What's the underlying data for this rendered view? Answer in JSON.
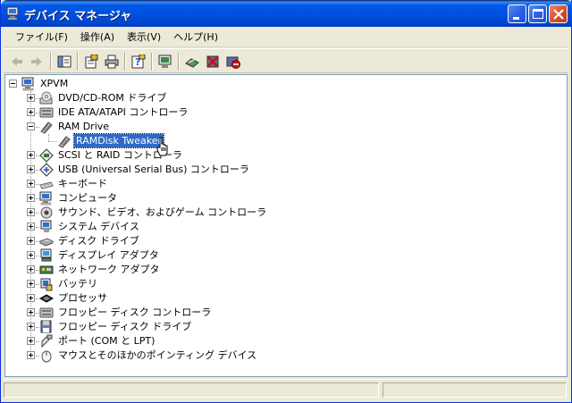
{
  "window": {
    "title": "デバイス マネージャ",
    "icon": "device-manager-icon",
    "controls": [
      "minimize-icon",
      "maximize-icon",
      "close-icon"
    ]
  },
  "menu": [
    {
      "label": "ファイル(F)"
    },
    {
      "label": "操作(A)"
    },
    {
      "label": "表示(V)"
    },
    {
      "label": "ヘルプ(H)"
    }
  ],
  "toolbar": {
    "icons": [
      "back-arrow-icon",
      "forward-arrow-icon",
      "show-hide-tree-icon",
      "properties-icon",
      "print-icon",
      "help-icon",
      "scan-hardware-icon",
      "update-driver-icon",
      "uninstall-icon",
      "disable-icon"
    ]
  },
  "tree": {
    "root": {
      "label": "XPVM",
      "icon": "computer-icon"
    },
    "categories": [
      {
        "label": "DVD/CD-ROM ドライブ",
        "icon": "cdrom-icon",
        "expanded": false
      },
      {
        "label": "IDE ATA/ATAPI コントローラ",
        "icon": "ide-controller-icon",
        "expanded": false
      },
      {
        "label": "RAM Drive",
        "icon": "ram-drive-icon",
        "expanded": true,
        "children": [
          {
            "label": "RAMDisk Tweaker",
            "icon": "ram-drive-icon",
            "selected": true
          }
        ]
      },
      {
        "label": "SCSI と RAID コントローラ",
        "icon": "scsi-icon",
        "expanded": false
      },
      {
        "label": "USB (Universal Serial Bus) コントローラ",
        "icon": "usb-icon",
        "expanded": false
      },
      {
        "label": "キーボード",
        "icon": "keyboard-icon",
        "expanded": false
      },
      {
        "label": "コンピュータ",
        "icon": "computer-icon",
        "expanded": false
      },
      {
        "label": "サウンド、ビデオ、およびゲーム コントローラ",
        "icon": "sound-icon",
        "expanded": false
      },
      {
        "label": "システム デバイス",
        "icon": "system-device-icon",
        "expanded": false
      },
      {
        "label": "ディスク ドライブ",
        "icon": "disk-drive-icon",
        "expanded": false
      },
      {
        "label": "ディスプレイ アダプタ",
        "icon": "display-adapter-icon",
        "expanded": false
      },
      {
        "label": "ネットワーク アダプタ",
        "icon": "network-adapter-icon",
        "expanded": false
      },
      {
        "label": "バッテリ",
        "icon": "battery-icon",
        "expanded": false
      },
      {
        "label": "プロセッサ",
        "icon": "processor-icon",
        "expanded": false
      },
      {
        "label": "フロッピー ディスク コントローラ",
        "icon": "floppy-controller-icon",
        "expanded": false
      },
      {
        "label": "フロッピー ディスク ドライブ",
        "icon": "floppy-drive-icon",
        "expanded": false
      },
      {
        "label": "ポート (COM と LPT)",
        "icon": "port-icon",
        "expanded": false
      },
      {
        "label": "マウスとそのほかのポインティング デバイス",
        "icon": "mouse-icon",
        "expanded": false
      }
    ]
  },
  "colors": {
    "titlebar": "#0054e3",
    "selection": "#316ac5",
    "chrome": "#ece9d8"
  }
}
